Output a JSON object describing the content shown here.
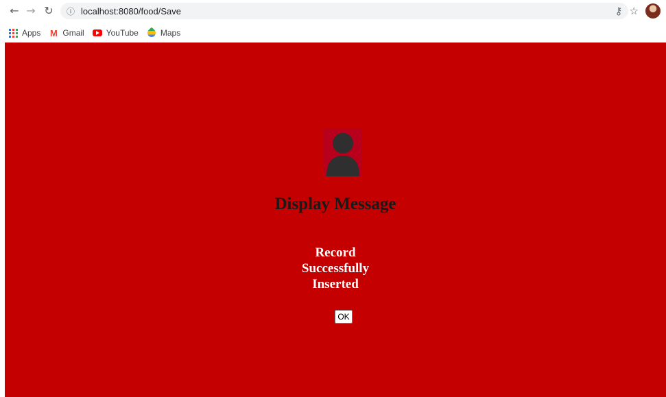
{
  "browser": {
    "url": "localhost:8080/food/Save",
    "icons": {
      "back": "arrow-left-icon",
      "forward": "arrow-right-icon",
      "reload": "reload-icon",
      "info": "info-icon",
      "key": "key-icon",
      "star": "star-icon"
    },
    "bookmarks": [
      {
        "label": "Apps",
        "icon": "apps-grid-icon"
      },
      {
        "label": "Gmail",
        "icon": "gmail-icon"
      },
      {
        "label": "YouTube",
        "icon": "youtube-icon"
      },
      {
        "label": "Maps",
        "icon": "maps-icon"
      }
    ]
  },
  "page": {
    "background_color": "#c40000",
    "heading": "Display Message",
    "message": "Record Successfully Inserted",
    "ok_label": "OK"
  }
}
